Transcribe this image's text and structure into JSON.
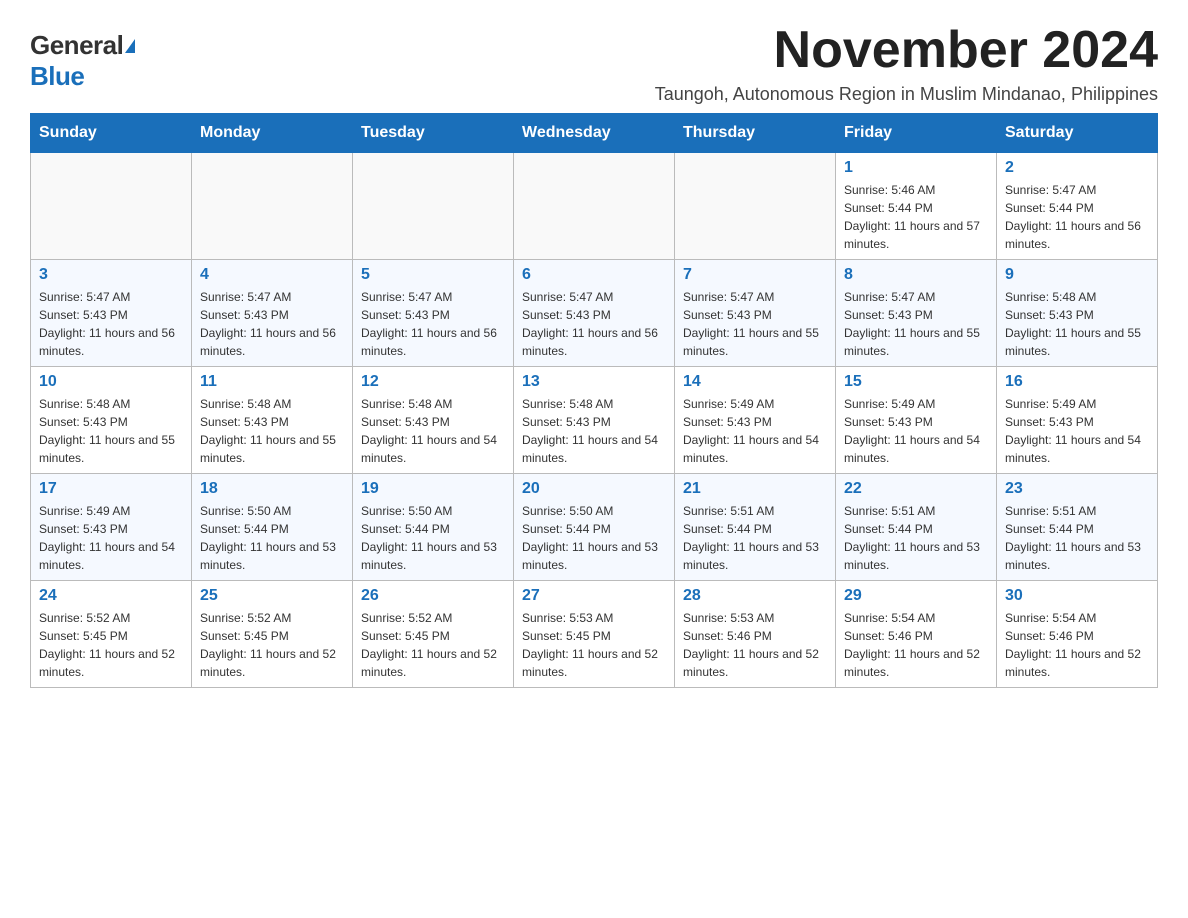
{
  "logo": {
    "general": "General",
    "blue": "Blue"
  },
  "header": {
    "month_year": "November 2024",
    "subtitle": "Taungoh, Autonomous Region in Muslim Mindanao, Philippines"
  },
  "days_header": [
    "Sunday",
    "Monday",
    "Tuesday",
    "Wednesday",
    "Thursday",
    "Friday",
    "Saturday"
  ],
  "weeks": [
    {
      "days": [
        {
          "number": "",
          "info": ""
        },
        {
          "number": "",
          "info": ""
        },
        {
          "number": "",
          "info": ""
        },
        {
          "number": "",
          "info": ""
        },
        {
          "number": "",
          "info": ""
        },
        {
          "number": "1",
          "info": "Sunrise: 5:46 AM\nSunset: 5:44 PM\nDaylight: 11 hours and 57 minutes."
        },
        {
          "number": "2",
          "info": "Sunrise: 5:47 AM\nSunset: 5:44 PM\nDaylight: 11 hours and 56 minutes."
        }
      ]
    },
    {
      "days": [
        {
          "number": "3",
          "info": "Sunrise: 5:47 AM\nSunset: 5:43 PM\nDaylight: 11 hours and 56 minutes."
        },
        {
          "number": "4",
          "info": "Sunrise: 5:47 AM\nSunset: 5:43 PM\nDaylight: 11 hours and 56 minutes."
        },
        {
          "number": "5",
          "info": "Sunrise: 5:47 AM\nSunset: 5:43 PM\nDaylight: 11 hours and 56 minutes."
        },
        {
          "number": "6",
          "info": "Sunrise: 5:47 AM\nSunset: 5:43 PM\nDaylight: 11 hours and 56 minutes."
        },
        {
          "number": "7",
          "info": "Sunrise: 5:47 AM\nSunset: 5:43 PM\nDaylight: 11 hours and 55 minutes."
        },
        {
          "number": "8",
          "info": "Sunrise: 5:47 AM\nSunset: 5:43 PM\nDaylight: 11 hours and 55 minutes."
        },
        {
          "number": "9",
          "info": "Sunrise: 5:48 AM\nSunset: 5:43 PM\nDaylight: 11 hours and 55 minutes."
        }
      ]
    },
    {
      "days": [
        {
          "number": "10",
          "info": "Sunrise: 5:48 AM\nSunset: 5:43 PM\nDaylight: 11 hours and 55 minutes."
        },
        {
          "number": "11",
          "info": "Sunrise: 5:48 AM\nSunset: 5:43 PM\nDaylight: 11 hours and 55 minutes."
        },
        {
          "number": "12",
          "info": "Sunrise: 5:48 AM\nSunset: 5:43 PM\nDaylight: 11 hours and 54 minutes."
        },
        {
          "number": "13",
          "info": "Sunrise: 5:48 AM\nSunset: 5:43 PM\nDaylight: 11 hours and 54 minutes."
        },
        {
          "number": "14",
          "info": "Sunrise: 5:49 AM\nSunset: 5:43 PM\nDaylight: 11 hours and 54 minutes."
        },
        {
          "number": "15",
          "info": "Sunrise: 5:49 AM\nSunset: 5:43 PM\nDaylight: 11 hours and 54 minutes."
        },
        {
          "number": "16",
          "info": "Sunrise: 5:49 AM\nSunset: 5:43 PM\nDaylight: 11 hours and 54 minutes."
        }
      ]
    },
    {
      "days": [
        {
          "number": "17",
          "info": "Sunrise: 5:49 AM\nSunset: 5:43 PM\nDaylight: 11 hours and 54 minutes."
        },
        {
          "number": "18",
          "info": "Sunrise: 5:50 AM\nSunset: 5:44 PM\nDaylight: 11 hours and 53 minutes."
        },
        {
          "number": "19",
          "info": "Sunrise: 5:50 AM\nSunset: 5:44 PM\nDaylight: 11 hours and 53 minutes."
        },
        {
          "number": "20",
          "info": "Sunrise: 5:50 AM\nSunset: 5:44 PM\nDaylight: 11 hours and 53 minutes."
        },
        {
          "number": "21",
          "info": "Sunrise: 5:51 AM\nSunset: 5:44 PM\nDaylight: 11 hours and 53 minutes."
        },
        {
          "number": "22",
          "info": "Sunrise: 5:51 AM\nSunset: 5:44 PM\nDaylight: 11 hours and 53 minutes."
        },
        {
          "number": "23",
          "info": "Sunrise: 5:51 AM\nSunset: 5:44 PM\nDaylight: 11 hours and 53 minutes."
        }
      ]
    },
    {
      "days": [
        {
          "number": "24",
          "info": "Sunrise: 5:52 AM\nSunset: 5:45 PM\nDaylight: 11 hours and 52 minutes."
        },
        {
          "number": "25",
          "info": "Sunrise: 5:52 AM\nSunset: 5:45 PM\nDaylight: 11 hours and 52 minutes."
        },
        {
          "number": "26",
          "info": "Sunrise: 5:52 AM\nSunset: 5:45 PM\nDaylight: 11 hours and 52 minutes."
        },
        {
          "number": "27",
          "info": "Sunrise: 5:53 AM\nSunset: 5:45 PM\nDaylight: 11 hours and 52 minutes."
        },
        {
          "number": "28",
          "info": "Sunrise: 5:53 AM\nSunset: 5:46 PM\nDaylight: 11 hours and 52 minutes."
        },
        {
          "number": "29",
          "info": "Sunrise: 5:54 AM\nSunset: 5:46 PM\nDaylight: 11 hours and 52 minutes."
        },
        {
          "number": "30",
          "info": "Sunrise: 5:54 AM\nSunset: 5:46 PM\nDaylight: 11 hours and 52 minutes."
        }
      ]
    }
  ]
}
